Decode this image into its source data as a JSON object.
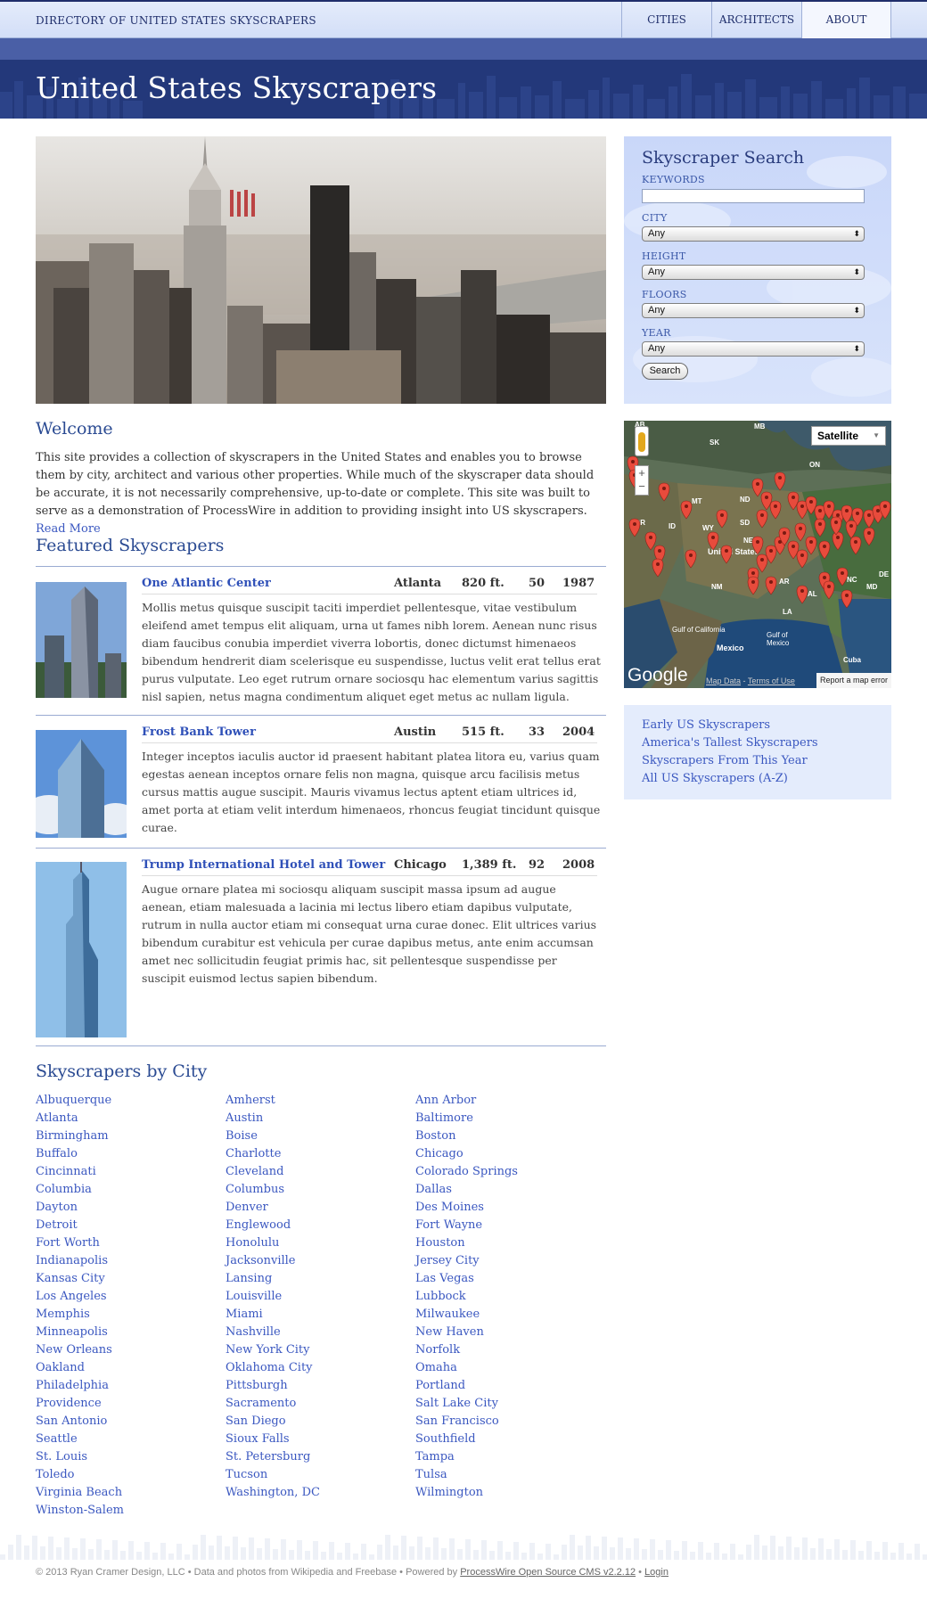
{
  "header": {
    "site_name": "DIRECTORY OF UNITED STATES SKYSCRAPERS",
    "nav": [
      "CITIES",
      "ARCHITECTS",
      "ABOUT"
    ],
    "active_nav": "ABOUT",
    "page_title": "United States Skyscrapers"
  },
  "search": {
    "title": "Skyscraper Search",
    "keywords_label": "KEYWORDS",
    "keywords_value": "",
    "city_label": "CITY",
    "city_value": "Any",
    "height_label": "HEIGHT",
    "height_value": "Any",
    "floors_label": "FLOORS",
    "floors_value": "Any",
    "year_label": "YEAR",
    "year_value": "Any",
    "button": "Search"
  },
  "map": {
    "type_button": "Satellite",
    "zoom_in": "+",
    "zoom_out": "−",
    "google": "Google",
    "map_data": "Map Data",
    "terms": "Terms of Use",
    "report": "Report a map error",
    "labels": [
      "AB",
      "MB",
      "SK",
      "ON",
      "MT",
      "ND",
      "OR",
      "ID",
      "WY",
      "SD",
      "NE",
      "United States",
      "NM",
      "AR",
      "AL",
      "LA",
      "NC",
      "MD",
      "DE",
      "Gulf of California",
      "Gulf of Mexico",
      "Mexico",
      "Cuba"
    ]
  },
  "quick_links": [
    "Early US Skyscrapers",
    "America's Tallest Skyscrapers",
    "Skyscrapers From This Year",
    "All US Skyscrapers (A-Z)"
  ],
  "welcome": {
    "title": "Welcome",
    "text": "This site provides a collection of skyscrapers in the United States and enables you to browse them by city, architect and various other properties. While much of the skyscraper data should be accurate, it is not necessarily comprehensive, up-to-date or complete. This site was built to serve as a demonstration of ProcessWire in addition to providing insight into US skyscrapers.",
    "read_more": "Read More"
  },
  "featured": {
    "title": "Featured Skyscrapers",
    "items": [
      {
        "name": "One Atlantic Center",
        "city": "Atlanta",
        "height": "820 ft.",
        "floors": "50",
        "year": "1987",
        "text": "Mollis metus quisque suscipit taciti imperdiet pellentesque, vitae vestibulum eleifend amet tempus elit aliquam, urna ut fames nibh lorem. Aenean nunc risus diam faucibus conubia imperdiet viverra lobortis, donec dictumst himenaeos bibendum hendrerit diam scelerisque eu suspendisse, luctus velit erat tellus erat purus vulputate. Leo eget rutrum ornare sociosqu hac elementum varius sagittis nisl sapien, netus magna condimentum aliquet eget metus ac nullam ligula."
      },
      {
        "name": "Frost Bank Tower",
        "city": "Austin",
        "height": "515 ft.",
        "floors": "33",
        "year": "2004",
        "text": "Integer inceptos iaculis auctor id praesent habitant platea litora eu, varius quam egestas aenean inceptos ornare felis non magna, quisque arcu facilisis metus cursus mattis augue suscipit. Mauris vivamus lectus aptent etiam ultrices id, amet porta at etiam velit interdum himenaeos, rhoncus feugiat tincidunt quisque curae."
      },
      {
        "name": "Trump International Hotel and Tower",
        "city": "Chicago",
        "height": "1,389 ft.",
        "floors": "92",
        "year": "2008",
        "text": "Augue ornare platea mi sociosqu aliquam suscipit massa ipsum ad augue aenean, etiam malesuada a lacinia mi lectus libero etiam dapibus vulputate, rutrum in nulla auctor etiam mi consequat urna curae donec. Elit ultrices varius bibendum curabitur est vehicula per curae dapibus metus, ante enim accumsan amet nec sollicitudin feugiat primis hac, sit pellentesque suspendisse per suscipit euismod lectus sapien bibendum."
      }
    ]
  },
  "cities": {
    "title": "Skyscrapers by City",
    "columns": [
      [
        "Albuquerque",
        "Atlanta",
        "Birmingham",
        "Buffalo",
        "Cincinnati",
        "Columbia",
        "Dayton",
        "Detroit",
        "Fort Worth",
        "Indianapolis",
        "Kansas City",
        "Los Angeles",
        "Memphis",
        "Minneapolis",
        "New Orleans",
        "Oakland",
        "Philadelphia",
        "Providence",
        "San Antonio",
        "Seattle",
        "St. Louis",
        "Toledo",
        "Virginia Beach",
        "Winston-Salem"
      ],
      [
        "Amherst",
        "Austin",
        "Boise",
        "Charlotte",
        "Cleveland",
        "Columbus",
        "Denver",
        "Englewood",
        "Honolulu",
        "Jacksonville",
        "Lansing",
        "Louisville",
        "Miami",
        "Nashville",
        "New York City",
        "Oklahoma City",
        "Pittsburgh",
        "Sacramento",
        "San Diego",
        "Sioux Falls",
        "St. Petersburg",
        "Tucson",
        "Washington, DC"
      ],
      [
        "Ann Arbor",
        "Baltimore",
        "Boston",
        "Chicago",
        "Colorado Springs",
        "Dallas",
        "Des Moines",
        "Fort Wayne",
        "Houston",
        "Jersey City",
        "Las Vegas",
        "Lubbock",
        "Milwaukee",
        "New Haven",
        "Norfolk",
        "Omaha",
        "Portland",
        "Salt Lake City",
        "San Francisco",
        "Southfield",
        "Tampa",
        "Tulsa",
        "Wilmington"
      ]
    ]
  },
  "footer": {
    "text": "© 2013 Ryan Cramer Design, LLC • Data and photos from Wikipedia and Freebase • Powered by",
    "cms_link": "ProcessWire Open Source CMS v2.2.12",
    "sep": "•",
    "login": "Login"
  },
  "colors": {
    "navy": "#23387a",
    "link": "#3a57c0",
    "search_bg": "#c9d7f9",
    "pin": "#e84b3c"
  }
}
